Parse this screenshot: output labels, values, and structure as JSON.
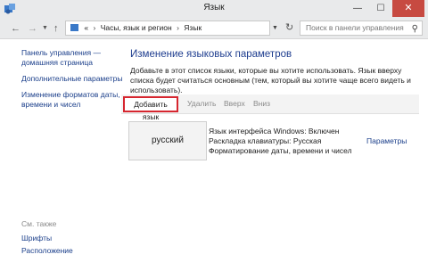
{
  "window": {
    "title": "Язык",
    "minimize": "—",
    "maximize": "☐",
    "close": "✕"
  },
  "addressbar": {
    "back": "←",
    "forward": "→",
    "history_drop": "▼",
    "up": "↑",
    "breadcrumb": [
      "Часы, язык и регион",
      "Язык"
    ],
    "breadcrumb_lead": "«",
    "separator": "›",
    "dropdown": "▼",
    "refresh": "↻",
    "search_placeholder": "Поиск в панели управления",
    "search_icon": "⚲"
  },
  "sidebar": {
    "links": [
      "Панель управления — домашняя страница",
      "Дополнительные параметры",
      "Изменение форматов даты, времени и чисел"
    ],
    "see_also_label": "См. также",
    "see_also": [
      "Шрифты",
      "Расположение"
    ]
  },
  "main": {
    "title": "Изменение языковых параметров",
    "description": "Добавьте в этот список языки, которые вы хотите использовать. Язык вверху списка будет считаться основным (тем, который вы хотите чаще всего видеть и использовать).",
    "toolbar": {
      "add": "Добавить язык",
      "remove": "Удалить",
      "up": "Вверх",
      "down": "Вниз"
    },
    "languages": [
      {
        "name": "русский",
        "details": [
          "Язык интерфейса Windows: Включен",
          "Раскладка клавиатуры: Русская",
          "Форматирование даты, времени и чисел"
        ],
        "options_link": "Параметры"
      }
    ]
  },
  "colors": {
    "highlight_border": "#d6262f",
    "link": "#1a3e8a",
    "title": "#1e3d8f",
    "close_button": "#c74a41"
  },
  "icons": {
    "app": "control-panel-icon",
    "address": "control-panel-icon",
    "search": "search-icon",
    "refresh": "refresh-icon"
  }
}
